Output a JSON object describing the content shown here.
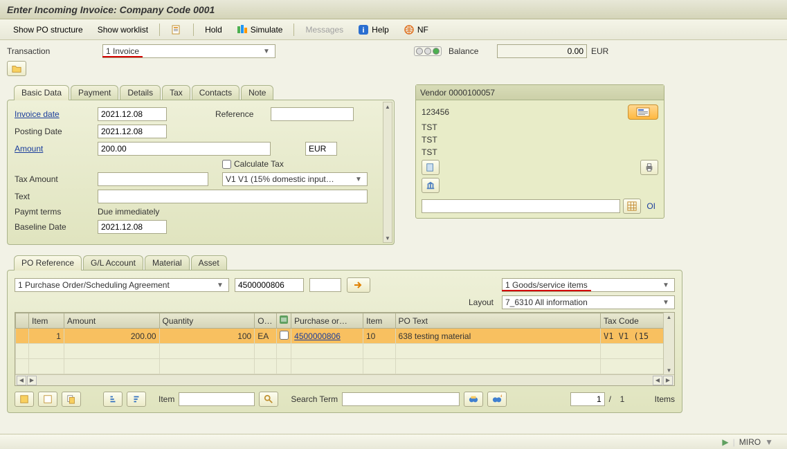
{
  "title": "Enter Incoming Invoice: Company Code 0001",
  "toolbar": {
    "show_po_structure": "Show PO structure",
    "show_worklist": "Show worklist",
    "hold": "Hold",
    "simulate": "Simulate",
    "messages": "Messages",
    "help": "Help",
    "nf": "NF"
  },
  "header": {
    "transaction_label": "Transaction",
    "transaction_value": "1 Invoice",
    "balance_label": "Balance",
    "balance_value": "0.00",
    "balance_currency": "EUR"
  },
  "tabs_upper": [
    "Basic Data",
    "Payment",
    "Details",
    "Tax",
    "Contacts",
    "Note"
  ],
  "basic": {
    "invoice_date_label": "Invoice date",
    "invoice_date": "2021.12.08",
    "reference_label": "Reference",
    "reference": "",
    "posting_date_label": "Posting Date",
    "posting_date": "2021.12.08",
    "amount_label": "Amount",
    "amount": "200.00",
    "currency": "EUR",
    "calculate_tax_label": "Calculate Tax",
    "tax_amount_label": "Tax Amount",
    "tax_amount": "",
    "tax_code": "V1 V1 (15% domestic input…",
    "text_label": "Text",
    "text": "",
    "paymt_terms_label": "Paymt terms",
    "paymt_terms": "Due immediately",
    "baseline_date_label": "Baseline Date",
    "baseline_date": "2021.12.08"
  },
  "vendor": {
    "head": "Vendor 0000100057",
    "line1": "123456",
    "line2": "TST",
    "line3": "TST",
    "line4": "TST",
    "oi_label": "OI"
  },
  "tabs_lower": [
    "PO Reference",
    "G/L Account",
    "Material",
    "Asset"
  ],
  "po": {
    "ref_type": "1 Purchase Order/Scheduling Agreement",
    "po_number": "4500000806",
    "view_mode": "1 Goods/service items",
    "layout_label": "Layout",
    "layout_value": "7_6310 All information",
    "cols": {
      "item": "Item",
      "amount": "Amount",
      "quantity": "Quantity",
      "uom": "O…",
      "po": "Purchase or…",
      "line_item": "Item",
      "po_text": "PO Text",
      "tax_code": "Tax Code"
    },
    "row": {
      "item": "1",
      "amount": "200.00",
      "quantity": "100",
      "uom": "EA",
      "po": "4500000806",
      "line_item": "10",
      "po_text": "638 testing material",
      "tax_code": "V1 V1 (15"
    },
    "footer": {
      "item_label": "Item",
      "search_label": "Search Term",
      "page_current": "1",
      "page_sep": "/",
      "page_total": "1",
      "items_label": "Items"
    }
  },
  "status": {
    "tcode": "MIRO"
  }
}
